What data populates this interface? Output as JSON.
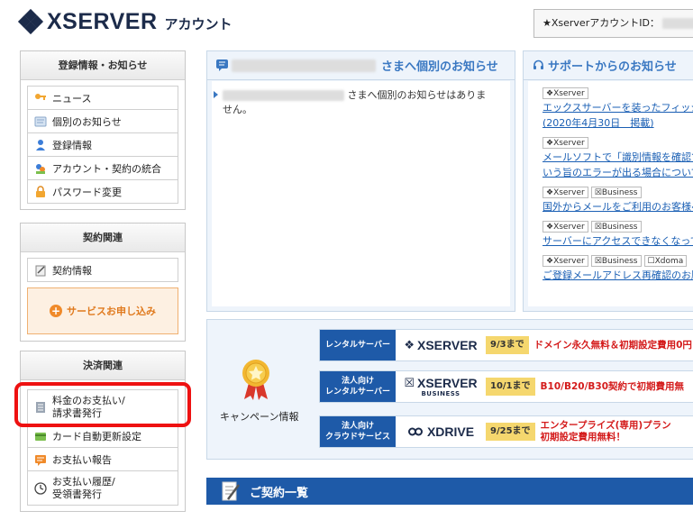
{
  "header": {
    "brand": "XSERVER",
    "brand_sub": "アカウント",
    "account_id_label": "★XserverアカウントID："
  },
  "sidebar": {
    "registration": {
      "title": "登録情報・お知らせ",
      "items": [
        {
          "label": "ニュース",
          "icon": "key-icon"
        },
        {
          "label": "個別のお知らせ",
          "icon": "message-icon"
        },
        {
          "label": "登録情報",
          "icon": "user-icon"
        },
        {
          "label": "アカウント・契約の統合",
          "icon": "merge-icon"
        },
        {
          "label": "パスワード変更",
          "icon": "lock-icon"
        }
      ]
    },
    "contract": {
      "title": "契約関連",
      "items": [
        {
          "label": "契約情報",
          "icon": "document-icon"
        }
      ],
      "apply_button": "サービスお申し込み"
    },
    "payment": {
      "title": "決済関連",
      "items": [
        {
          "label_line1": "料金のお支払い/",
          "label_line2": "請求書発行",
          "icon": "invoice-icon"
        },
        {
          "label": "カード自動更新設定",
          "icon": "card-icon"
        },
        {
          "label": "お支払い報告",
          "icon": "report-icon"
        },
        {
          "label_line1": "お支払い履歴/",
          "label_line2": "受領書発行",
          "icon": "clock-icon"
        }
      ]
    }
  },
  "notices": {
    "personal": {
      "title_suffix": "さまへ個別のお知らせ",
      "message_suffix": "さまへ個別のお知らせはありま",
      "message_line2": "せん。"
    },
    "support": {
      "title": "サポートからのお知らせ",
      "entries": [
        {
          "tags": [
            "Xserver"
          ],
          "link_line1": "エックスサーバーを装ったフィッシ",
          "link_line2": "(2020年4月30日　掲載)"
        },
        {
          "tags": [
            "Xserver"
          ],
          "link_line1": "メールソフトで「識別情報を確認で",
          "link_line2": "いう旨のエラーが出る場合について"
        },
        {
          "tags": [
            "Xserver",
            "Business"
          ],
          "link_line1": "国外からメールをご利用のお客様へ"
        },
        {
          "tags": [
            "Xserver",
            "Business"
          ],
          "link_line1": "サーバーにアクセスできなくなって"
        },
        {
          "tags": [
            "Xserver",
            "Business",
            "Xdoma"
          ],
          "link_line1": "ご登録メールアドレス再確認のお願"
        }
      ]
    }
  },
  "campaign": {
    "label": "キャンペーン情報",
    "rows": [
      {
        "category": "レンタルサーバー",
        "logo": "XSERVER",
        "logo_sub": "",
        "date": "9/3まで",
        "text": "ドメイン永久無料＆初期設定費用0円"
      },
      {
        "category_line1": "法人向け",
        "category_line2": "レンタルサーバー",
        "logo": "XSERVER",
        "logo_sub": "BUSINESS",
        "date": "10/1まで",
        "text": "B10/B20/B30契約で初期費用無"
      },
      {
        "category_line1": "法人向け",
        "category_line2": "クラウドサービス",
        "logo": "XDRIVE",
        "logo_sub": "",
        "date": "9/25まで",
        "text_line1": "エンタープライズ(専用)プラン",
        "text_line2": "初期設定費用無料！"
      }
    ]
  },
  "contract_list": {
    "title": "ご契約一覧"
  },
  "colors": {
    "accent_blue": "#1e5aa8",
    "link_blue": "#1a5fb4",
    "highlight_red": "#ee1111",
    "campaign_red": "#d41c1c"
  }
}
